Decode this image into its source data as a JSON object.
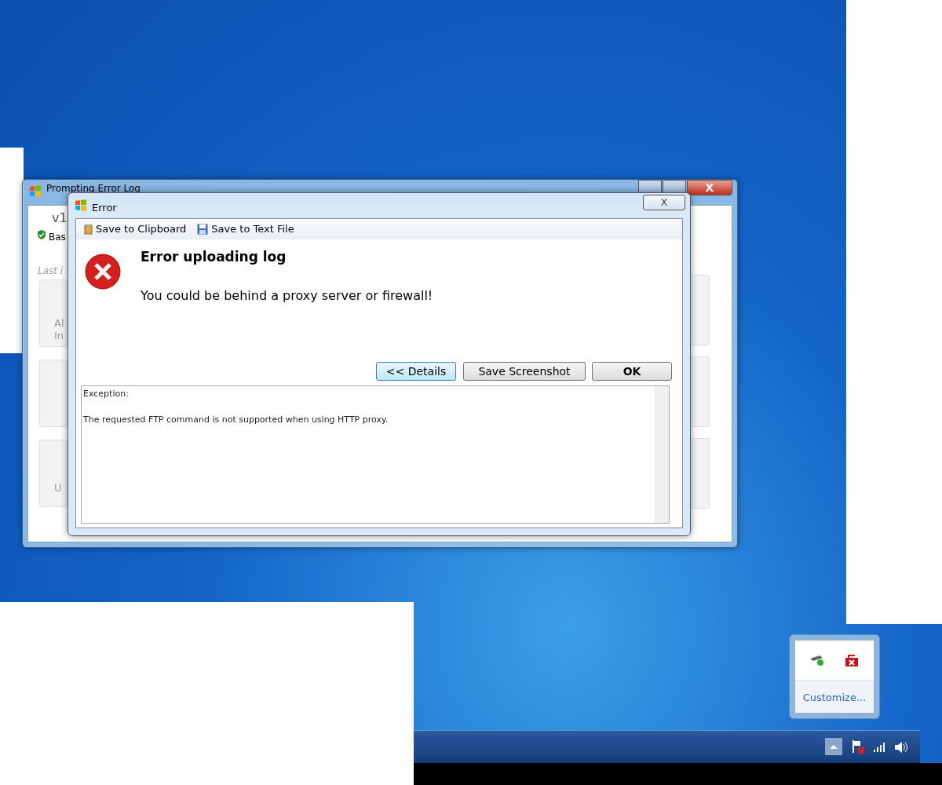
{
  "background_window": {
    "title": "Prompting Error Log",
    "close_label": "X",
    "version_label": "v1",
    "tab_label": "Bas",
    "group_label": "Last i",
    "tile_texts": [
      "Al",
      "In",
      "U"
    ]
  },
  "dialog": {
    "title": "Error",
    "close_label": "X",
    "toolbar": [
      {
        "kind": "clipboard",
        "label": "Save to Clipboard"
      },
      {
        "kind": "file",
        "label": "Save to Text File"
      }
    ],
    "heading": "Error uploading log",
    "message": "You could be behind a proxy server or firewall!",
    "buttons": [
      {
        "label": "<< Details",
        "kind": "focused"
      },
      {
        "label": "Save Screenshot",
        "kind": "normal"
      },
      {
        "label": "OK",
        "kind": "default"
      }
    ],
    "details": [
      "Exception:",
      "The requested FTP command is not supported when using HTTP proxy."
    ]
  },
  "tray_popup": {
    "link": "Customize..."
  }
}
